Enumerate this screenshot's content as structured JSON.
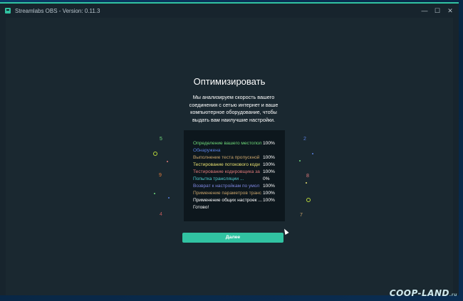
{
  "window": {
    "title": "Streamlabs OBS - Version: 0.11.3",
    "minimize_glyph": "—",
    "maximize_glyph": "☐",
    "close_glyph": "✕"
  },
  "main": {
    "heading": "Оптимизировать",
    "description": "Мы анализируем скорость вашего соединения с сетью интернет и ваше компьютерное оборудование, чтобы выдать вам наилучшие настройки.",
    "button_label": "Далее"
  },
  "log": {
    "rows": [
      {
        "step": "Определение вашего местопол",
        "value": "100%",
        "color": "#6fda7a"
      },
      {
        "step": "Обнаружена",
        "value": "",
        "color": "#5a7fe0"
      },
      {
        "step": "Выполнение теста пропускной",
        "value": "100%",
        "color": "#c9a36a"
      },
      {
        "step": "Тестирование потокового коди",
        "value": "100%",
        "color": "#e8e070"
      },
      {
        "step": "Тестирование кодировщика за",
        "value": "100%",
        "color": "#e07a7a"
      },
      {
        "step": "Попытка трансляции ...",
        "value": "0%",
        "color": "#4ecfd0"
      },
      {
        "step": "Возврат к настройкам по умол",
        "value": "100%",
        "color": "#7e86e0"
      },
      {
        "step": "Применение параметров транс",
        "value": "100%",
        "color": "#c9a36a"
      },
      {
        "step": "Применение общих настроек ...",
        "value": "100%",
        "color": "#ffffff"
      },
      {
        "step": "Готово!",
        "value": "",
        "color": "#ffffff"
      }
    ]
  },
  "confetti": [
    "5",
    "9",
    "4",
    "2",
    "8",
    "7"
  ],
  "watermark": {
    "text": "COOP-LAND",
    "suffix": ".ru"
  },
  "colors": {
    "accent": "#31c3a2",
    "background": "#1a2830",
    "log_background": "#0d171d"
  }
}
